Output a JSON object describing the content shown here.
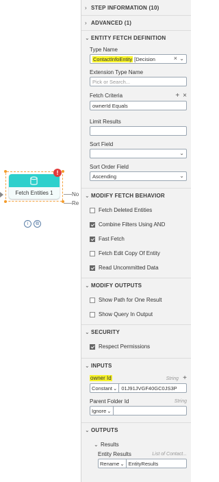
{
  "canvas": {
    "step_name": "Fetch Entities 1",
    "error_badge": "!",
    "info_icon": "i",
    "copy_icon": "⧉",
    "out_labels": [
      "No",
      "Re"
    ]
  },
  "sections": {
    "step_information": "STEP INFORMATION (10)",
    "advanced": "ADVANCED (1)",
    "entity_fetch_definition": "ENTITY FETCH DEFINITION",
    "modify_fetch_behavior": "MODIFY FETCH BEHAVIOR",
    "modify_outputs": "MODIFY OUTPUTS",
    "security": "SECURITY",
    "inputs": "INPUTS",
    "outputs": "OUTPUTS"
  },
  "entity_fetch": {
    "type_name_label": "Type Name",
    "type_name_value": "ContactInfoEntity",
    "type_name_suffix": "[Decision",
    "extension_type_label": "Extension Type Name",
    "extension_placeholder": "Pick or Search...",
    "fetch_criteria_label": "Fetch Criteria",
    "fetch_criteria_value": "ownerId Equals",
    "limit_results_label": "Limit Results",
    "sort_field_label": "Sort Field",
    "sort_order_label": "Sort Order Field",
    "sort_order_value": "Ascending"
  },
  "fetch_behavior": {
    "items": [
      {
        "label": "Fetch Deleted Entities",
        "checked": false
      },
      {
        "label": "Combine Filters Using AND",
        "checked": true
      },
      {
        "label": "Fast Fetch",
        "checked": true
      },
      {
        "label": "Fetch Edit Copy Of Entity",
        "checked": false
      },
      {
        "label": "Read Uncommitted Data",
        "checked": true
      }
    ]
  },
  "modify_outputs": {
    "items": [
      {
        "label": "Show Path for One Result",
        "checked": false
      },
      {
        "label": "Show Query In Output",
        "checked": false
      }
    ]
  },
  "security": {
    "items": [
      {
        "label": "Respect Permissions",
        "checked": true
      }
    ]
  },
  "inputs": {
    "owner_label": "owner Id",
    "owner_type": "String",
    "owner_add": "+",
    "owner_mode": "Constant",
    "owner_value": "01J91JVGF40GC0JS3P",
    "parent_label": "Parent Folder Id",
    "parent_type": "String",
    "parent_mode": "Ignore"
  },
  "outputs": {
    "results_label": "Results",
    "entity_results_label": "Entity Results",
    "entity_results_type": "List of Contact...",
    "entity_results_mode": "Rename",
    "entity_results_value": "EntityResults"
  },
  "icons": {
    "chevron_right": "›",
    "chevron_down": "⌄",
    "plus": "+",
    "close": "×"
  },
  "colors": {
    "step_teal": "#2ed0cc",
    "selection_orange": "#f39c2b",
    "error_red": "#e23b3b",
    "highlight_yellow": "#f7f32a"
  }
}
